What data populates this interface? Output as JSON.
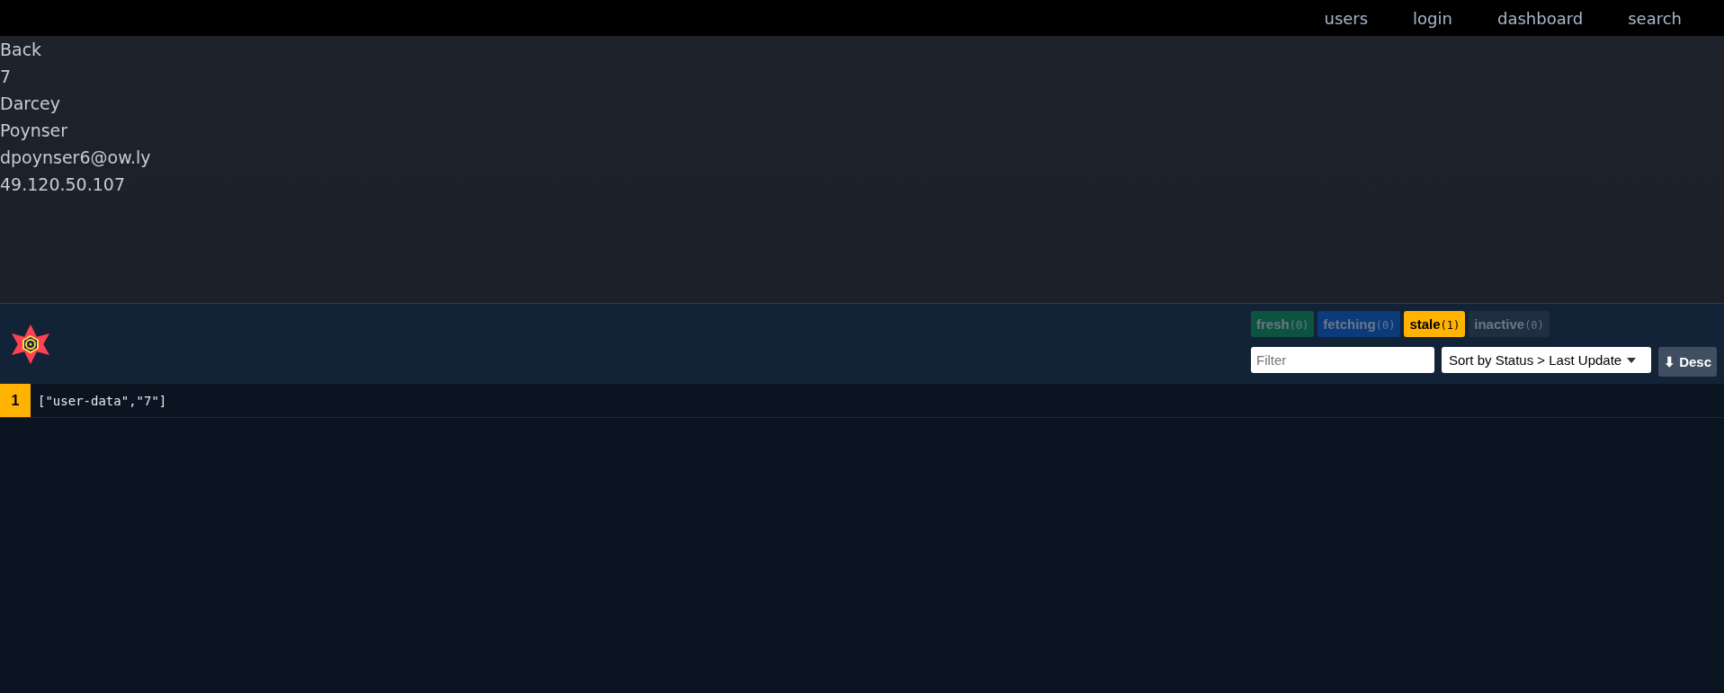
{
  "nav": {
    "links": [
      "users",
      "login",
      "dashboard",
      "search"
    ]
  },
  "user": {
    "back": "Back",
    "fields": [
      "7",
      "Darcey",
      "Poynser",
      "dpoynser6@ow.ly",
      "49.120.50.107"
    ]
  },
  "devtools": {
    "status_badges": [
      {
        "label": "fresh",
        "count": "(0)",
        "color": "#0d5440",
        "dimmed": true
      },
      {
        "label": "fetching",
        "count": "(0)",
        "color": "#0c3b7c",
        "dimmed": true
      },
      {
        "label": "stale",
        "count": "(1)",
        "color": "#ffb200",
        "dimmed": false
      },
      {
        "label": "inactive",
        "count": "(0)",
        "color": "#1f2e40",
        "dimmed": true
      }
    ],
    "filter": {
      "placeholder": "Filter"
    },
    "sort": {
      "value": "Sort by Status > Last Update"
    },
    "order_button": {
      "icon": "⬇",
      "label": "Desc"
    },
    "queries": [
      {
        "observers": "1",
        "key": "[\"user-data\",\"7\"]",
        "color": "#ffb200"
      }
    ]
  }
}
